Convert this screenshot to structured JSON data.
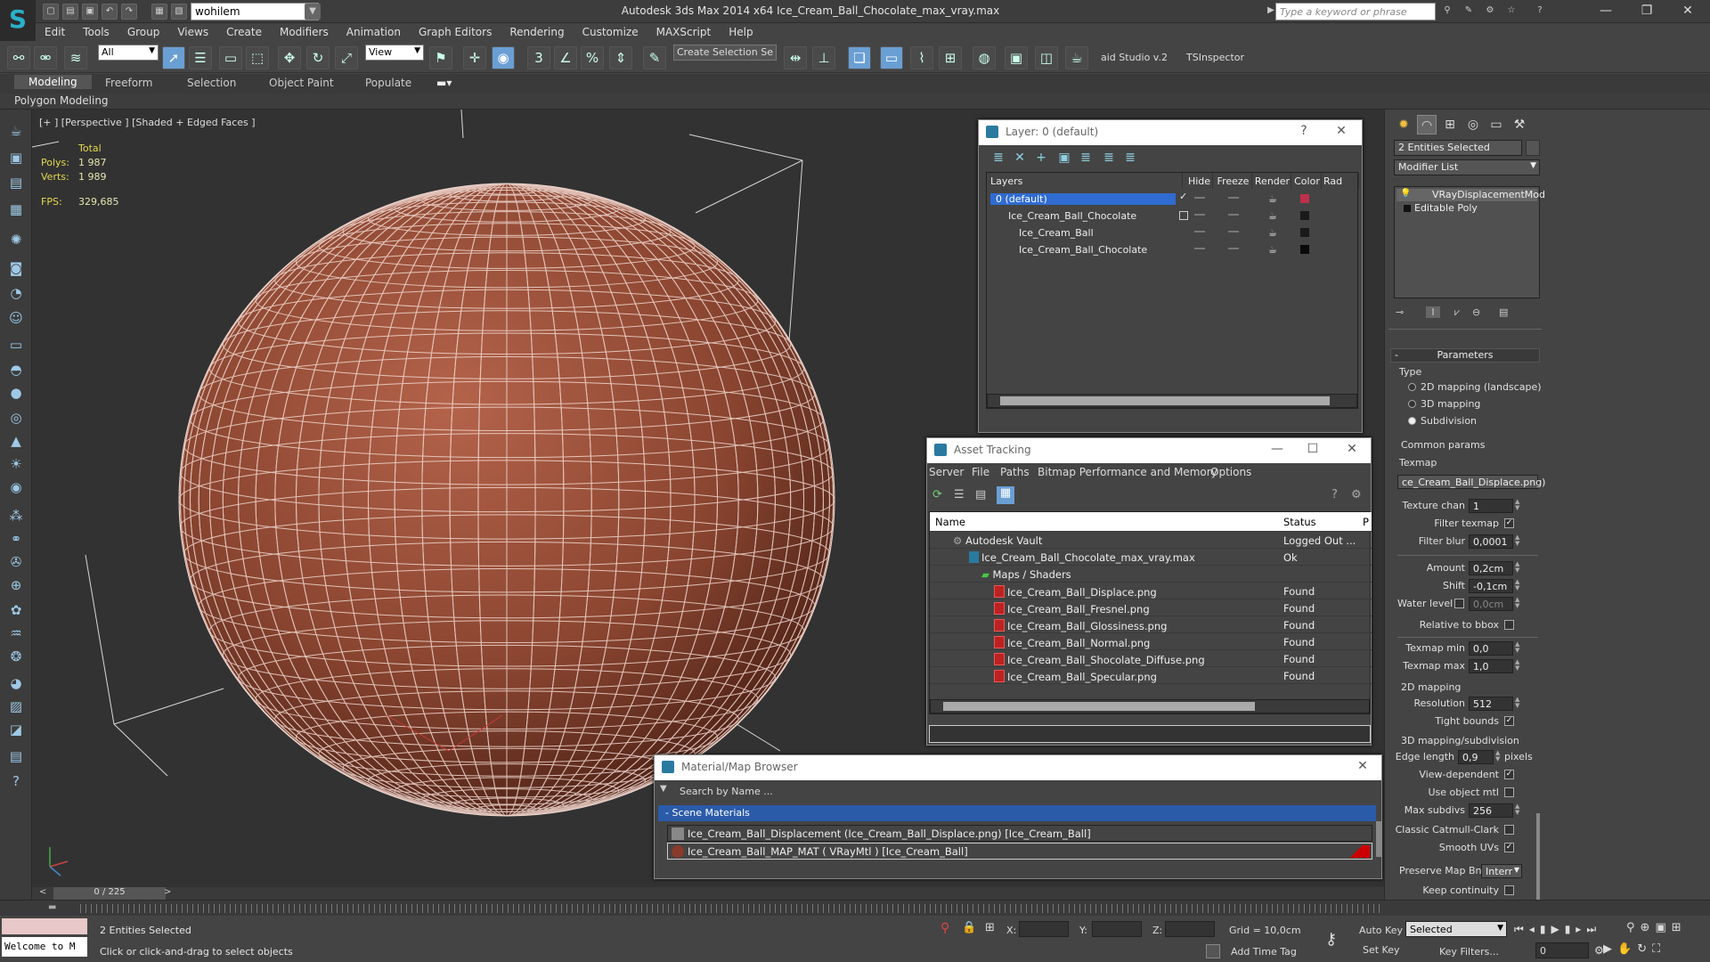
{
  "app": {
    "title": "Autodesk 3ds Max  2014 x64     Ice_Cream_Ball_Chocolate_max_vray.max",
    "workspace": "wohilem",
    "keyword_search_placeholder": "Type a keyword or phrase"
  },
  "menu": [
    "Edit",
    "Tools",
    "Group",
    "Views",
    "Create",
    "Modifiers",
    "Animation",
    "Graph Editors",
    "Rendering",
    "Customize",
    "MAXScript",
    "Help"
  ],
  "toolbar": {
    "selection_filter": "All",
    "ref_coord": "View",
    "selection_set": "Create Selection Se",
    "studio_label": "aid Studio v.2",
    "tsinspector": "TSInspector"
  },
  "ribbon": {
    "tabs": [
      "Modeling",
      "Freeform",
      "Selection",
      "Object Paint",
      "Populate"
    ],
    "active": "Modeling",
    "sub": "Polygon Modeling"
  },
  "viewport": {
    "label": "[+ ] [Perspective ] [Shaded + Edged Faces ]",
    "stats": {
      "total_label": "Total",
      "polys_label": "Polys:",
      "polys": "1 987",
      "verts_label": "Verts:",
      "verts": "1 989",
      "fps_label": "FPS:",
      "fps": "329,685"
    },
    "sphere_color": "#8a4530"
  },
  "layer_panel": {
    "title": "Layer: 0 (default)",
    "columns": [
      "Layers",
      "Hide",
      "Freeze",
      "Render",
      "Color",
      "Rad"
    ],
    "rows": [
      {
        "name": "0 (default)",
        "color": "#c0304a",
        "selected": true
      },
      {
        "name": "Ice_Cream_Ball_Chocolate",
        "color": "#1a1a1a",
        "selected": false
      },
      {
        "name": "Ice_Cream_Ball",
        "color": "#1a1a1a",
        "selected": false
      },
      {
        "name": "Ice_Cream_Ball_Chocolate",
        "color": "#0a0a0a",
        "selected": false
      }
    ]
  },
  "asset_panel": {
    "title": "Asset Tracking",
    "menu": [
      "Server",
      "File",
      "Paths",
      "Bitmap Performance and Memory",
      "Options"
    ],
    "columns": [
      "Name",
      "Status",
      "P"
    ],
    "rows": [
      {
        "name": "Autodesk Vault",
        "status": "Logged Out ..."
      },
      {
        "name": "Ice_Cream_Ball_Chocolate_max_vray.max",
        "status": "Ok"
      },
      {
        "name": "Maps / Shaders",
        "status": ""
      },
      {
        "name": "Ice_Cream_Ball_Displace.png",
        "status": "Found"
      },
      {
        "name": "Ice_Cream_Ball_Fresnel.png",
        "status": "Found"
      },
      {
        "name": "Ice_Cream_Ball_Glossiness.png",
        "status": "Found"
      },
      {
        "name": "Ice_Cream_Ball_Normal.png",
        "status": "Found"
      },
      {
        "name": "Ice_Cream_Ball_Shocolate_Diffuse.png",
        "status": "Found"
      },
      {
        "name": "Ice_Cream_Ball_Specular.png",
        "status": "Found"
      }
    ]
  },
  "material_browser": {
    "title": "Material/Map Browser",
    "search_placeholder": "Search by Name ...",
    "section": "- Scene Materials",
    "items": [
      "Ice_Cream_Ball_Displacement (Ice_Cream_Ball_Displace.png) [Ice_Cream_Ball]",
      "Ice_Cream_Ball_MAP_MAT  ( VRayMtl )  [Ice_Cream_Ball]"
    ]
  },
  "command_panel": {
    "selection": "2 Entities Selected",
    "modifier_list": "Modifier List",
    "stack": [
      "VRayDisplacementMod",
      "Editable Poly"
    ],
    "parameters_title": "Parameters",
    "type_label": "Type",
    "type_options": [
      "2D mapping (landscape)",
      "3D mapping",
      "Subdivision"
    ],
    "type_selected": 2,
    "common_params": "Common params",
    "texmap_label": "Texmap",
    "texmap": "ce_Cream_Ball_Displace.png)",
    "texture_chan_label": "Texture chan",
    "texture_chan": "1",
    "filter_texmap_label": "Filter texmap",
    "filter_blur_label": "Filter blur",
    "filter_blur": "0,0001",
    "amount_label": "Amount",
    "amount": "0,2cm",
    "shift_label": "Shift",
    "shift": "-0,1cm",
    "water_level_label": "Water level",
    "water_level": "0,0cm",
    "relative_bbox_label": "Relative to bbox",
    "texmap_min_label": "Texmap min",
    "texmap_min": "0,0",
    "texmap_max_label": "Texmap max",
    "texmap_max": "1,0",
    "mapping2d_label": "2D mapping",
    "resolution_label": "Resolution",
    "resolution": "512",
    "tight_bounds_label": "Tight bounds",
    "mapping3d_label": "3D mapping/subdivision",
    "edge_length_label": "Edge length",
    "edge_length": "0,9",
    "pixels_label": "pixels",
    "view_dependent_label": "View-dependent",
    "use_object_mtl_label": "Use object mtl",
    "max_subdivs_label": "Max subdivs",
    "max_subdivs": "256",
    "catmull_label": "Classic Catmull-Clark",
    "smooth_uvs_label": "Smooth UVs",
    "preserve_label": "Preserve Map Bnd",
    "preserve": "Interr",
    "keep_continuity_label": "Keep continuity"
  },
  "timeline": {
    "frame": "0 / 225"
  },
  "status": {
    "selected": "2 Entities Selected",
    "prompt": "Click or click-and-drag to select objects",
    "maxscript": "Welcome to M",
    "x_label": "X:",
    "y_label": "Y:",
    "z_label": "Z:",
    "grid": "Grid = 10,0cm",
    "autokey": "Auto Key",
    "setkey": "Set Key",
    "key_mode": "Selected",
    "key_filters": "Key Filters...",
    "add_time_tag": "Add Time Tag",
    "frame_field": "0"
  }
}
